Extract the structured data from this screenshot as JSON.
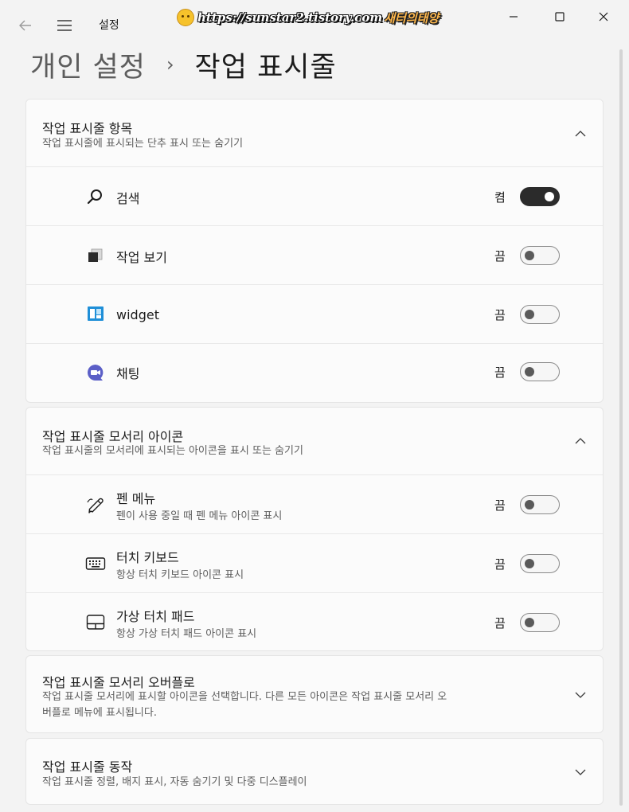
{
  "window": {
    "title": "설정",
    "watermark_url": "https://sunstar2.tistory.com",
    "watermark_name": "새터의태양"
  },
  "breadcrumb": {
    "parent": "개인 설정",
    "separator": "›",
    "current": "작업 표시줄"
  },
  "sections": [
    {
      "title": "작업 표시줄 항목",
      "description": "작업 표시줄에 표시되는 단추 표시 또는 숨기기",
      "expanded": true,
      "items": [
        {
          "label": "검색",
          "state": "켬",
          "on": true,
          "icon": "search-icon"
        },
        {
          "label": "작업 보기",
          "state": "끔",
          "on": false,
          "icon": "task-view-icon"
        },
        {
          "label": "widget",
          "state": "끔",
          "on": false,
          "icon": "widgets-icon"
        },
        {
          "label": "채팅",
          "state": "끔",
          "on": false,
          "icon": "chat-icon"
        }
      ]
    },
    {
      "title": "작업 표시줄 모서리 아이콘",
      "description": "작업 표시줄의 모서리에 표시되는 아이콘을 표시 또는 숨기기",
      "expanded": true,
      "items": [
        {
          "label": "펜 메뉴",
          "sub": "펜이 사용 중일 때 펜 메뉴 아이콘 표시",
          "state": "끔",
          "on": false,
          "icon": "pen-icon"
        },
        {
          "label": "터치 키보드",
          "sub": "항상 터치 키보드 아이콘 표시",
          "state": "끔",
          "on": false,
          "icon": "keyboard-icon"
        },
        {
          "label": "가상 터치 패드",
          "sub": "항상 가상 터치 패드 아이콘 표시",
          "state": "끔",
          "on": false,
          "icon": "touchpad-icon"
        }
      ]
    },
    {
      "title": "작업 표시줄 모서리 오버플로",
      "description_line1": "작업 표시줄 모서리에 표시할 아이콘을 선택합니다. 다른 모든 아이콘은 작업 표시줄 모서리 오",
      "description_line2": "버플로 메뉴에 표시됩니다.",
      "expanded": false
    },
    {
      "title": "작업 표시줄 동작",
      "description": "작업 표시줄 정렬, 배지 표시, 자동 숨기기 및 다중 디스플레이",
      "expanded": false
    }
  ],
  "colors": {
    "background": "#f3f3f3",
    "card": "#fbfbfb",
    "toggle_on": "#2b2b2b",
    "widgets_blue": "#1f8fd8",
    "chat_purple": "#5b5fc7"
  }
}
